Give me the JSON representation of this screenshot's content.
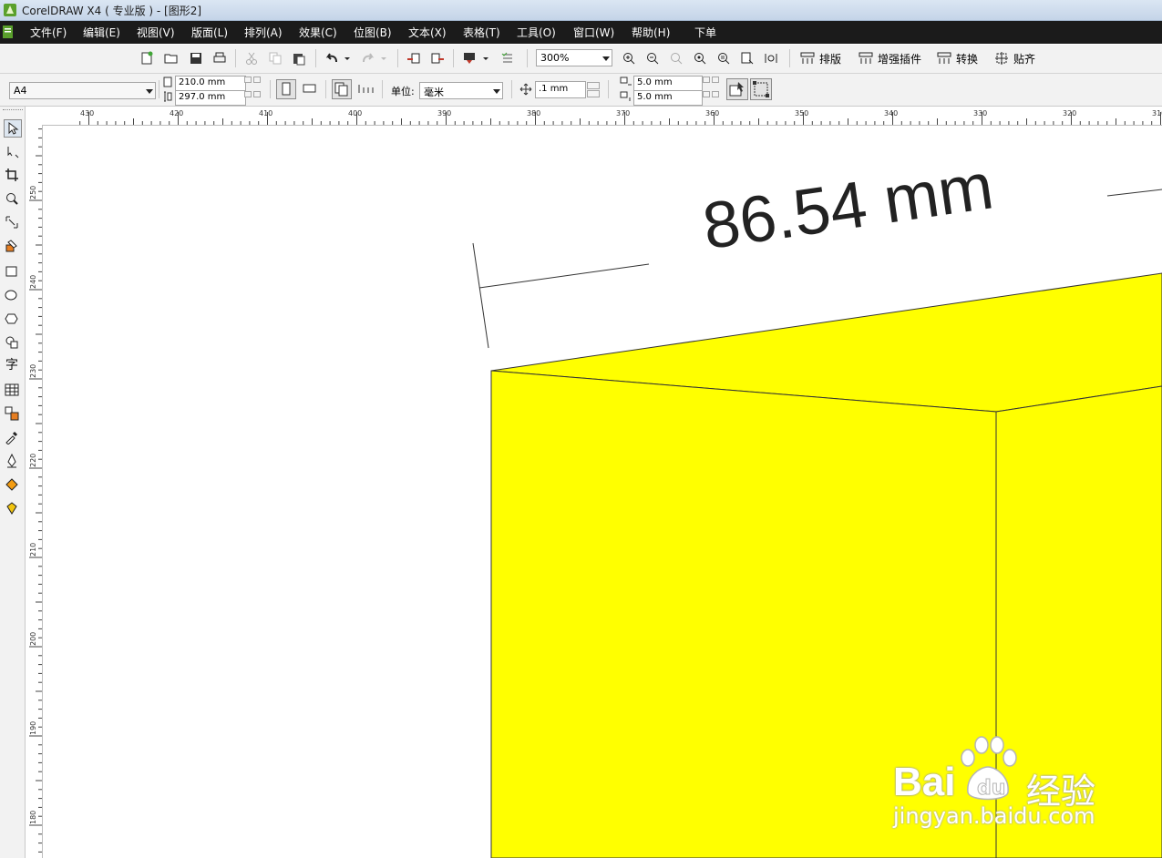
{
  "window": {
    "title": "CorelDRAW X4 ( 专业版 ) - [图形2]"
  },
  "menu": {
    "items": [
      {
        "label": "文件(F)"
      },
      {
        "label": "编辑(E)"
      },
      {
        "label": "视图(V)"
      },
      {
        "label": "版面(L)"
      },
      {
        "label": "排列(A)"
      },
      {
        "label": "效果(C)"
      },
      {
        "label": "位图(B)"
      },
      {
        "label": "文本(X)"
      },
      {
        "label": "表格(T)"
      },
      {
        "label": "工具(O)"
      },
      {
        "label": "窗口(W)"
      },
      {
        "label": "帮助(H)"
      },
      {
        "label": "下单"
      }
    ]
  },
  "toolbar": {
    "zoom_value": "300%",
    "buttons": {
      "layout": "排版",
      "enhance": "增强插件",
      "convert": "转换",
      "snap": "贴齐"
    }
  },
  "property_bar": {
    "page_size": "A4",
    "width": "210.0 mm",
    "height": "297.0 mm",
    "unit_label": "单位:",
    "unit_value": "毫米",
    "nudge": ".1 mm",
    "dup_x": "5.0 mm",
    "dup_y": "5.0 mm"
  },
  "rulers": {
    "top": [
      "430",
      "420",
      "410",
      "400",
      "390",
      "380",
      "370",
      "360",
      "350",
      "340",
      "330",
      "320",
      "310"
    ],
    "left": [
      "250",
      "240",
      "230",
      "220",
      "210",
      "200",
      "190",
      "180"
    ]
  },
  "drawing": {
    "dimension_text": "86.54 mm",
    "box_color": "#ffff00"
  },
  "watermark": {
    "brand": "Bai",
    "brand_cn": "经验",
    "url": "jingyan.baidu.com"
  }
}
